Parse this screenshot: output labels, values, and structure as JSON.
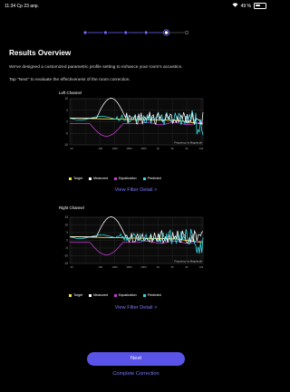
{
  "status": {
    "time": "11:34",
    "date": "Ср 23 апр.",
    "battery": "49 %",
    "battery_level": 0.49
  },
  "progress": {
    "total_steps": 6,
    "current_step": 5
  },
  "title": "Results Overview",
  "description1": "We've designed a customized parametric profile setting to enhance your room's acoustics.",
  "description2": "Tap \"Next\" to evaluate the effectiveness of the room correction.",
  "left": {
    "label": "Left Channel",
    "y_ticks": [
      "10",
      "5",
      "0",
      "-5",
      "-10"
    ],
    "x_ticks": [
      "20",
      "",
      "100",
      "1000",
      "1500",
      "2000",
      "3k",
      "5k",
      "6k",
      "10k"
    ],
    "freq_label": "Frequency vs Magnitude",
    "link": "View Filter Detail >"
  },
  "right": {
    "label": "Right Channel",
    "y_ticks": [
      "15",
      "10",
      "5",
      "0",
      "-5",
      "-10",
      "-15"
    ],
    "x_ticks": [
      "20",
      "",
      "100",
      "1000",
      "1500",
      "2000",
      "3k",
      "5k",
      "6k",
      "10k"
    ],
    "freq_label": "Frequency vs Magnitude",
    "link": "View Filter Detail >"
  },
  "legend": {
    "target": "Target",
    "measured": "Measured",
    "equalization": "Equalization",
    "predicted": "Predicted",
    "colors": {
      "target": "#f5e63c",
      "measured": "#ffffff",
      "equalization": "#c23ad0",
      "predicted": "#35d9e6"
    }
  },
  "buttons": {
    "next": "Next",
    "complete": "Complete Correction"
  }
}
